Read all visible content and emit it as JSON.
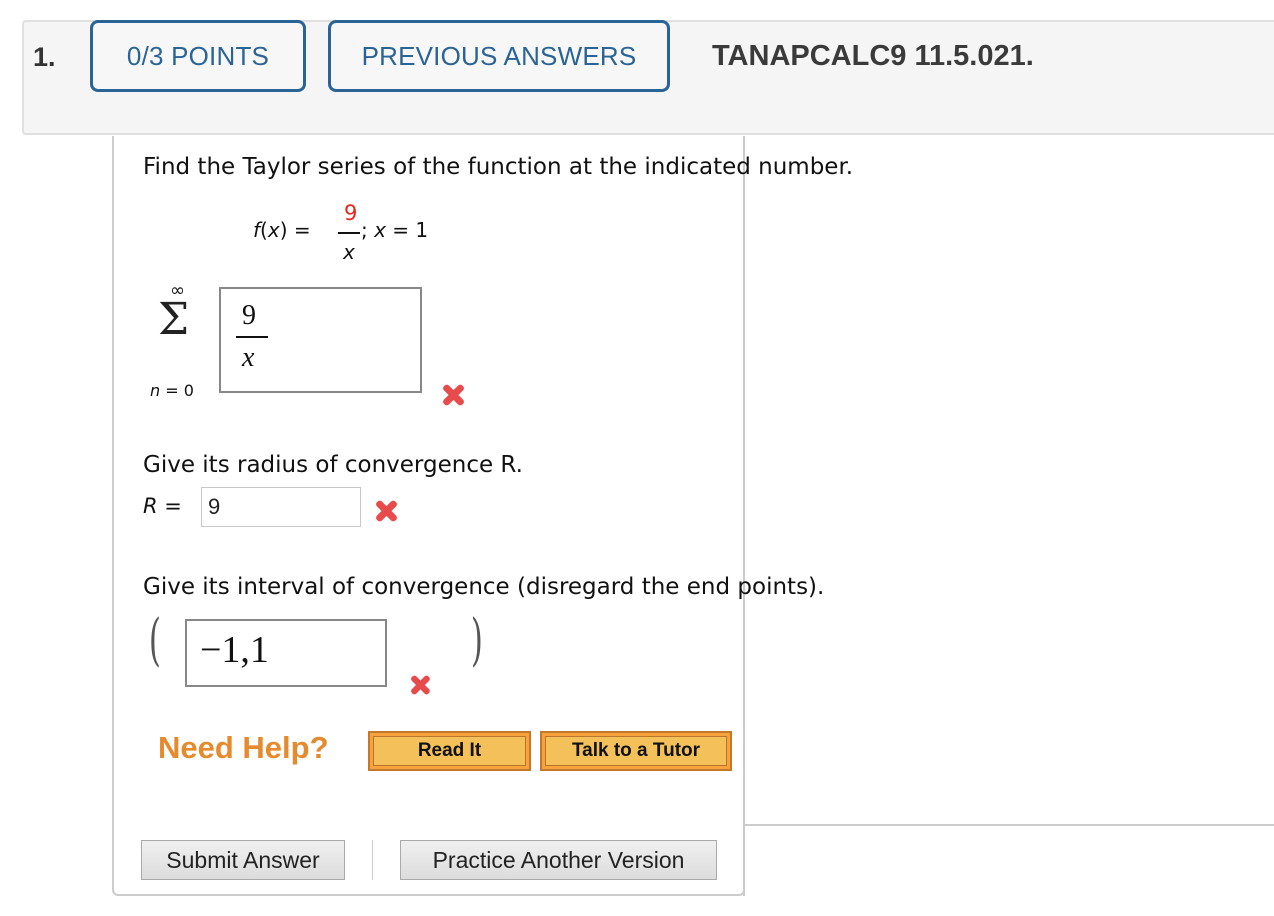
{
  "header": {
    "question_number": "1.",
    "points_label": "0/3 POINTS",
    "previous_answers_label": "PREVIOUS ANSWERS",
    "question_id": "TANAPCALC9 11.5.021."
  },
  "question": {
    "prompt": "Find the Taylor series of the function at the indicated number.",
    "function": {
      "lhs": "f(x) =",
      "numerator": "9",
      "denominator": "x",
      "rest": "; x = 1"
    },
    "series": {
      "upper_limit": "∞",
      "sigma": "Σ",
      "lower_limit_var": "n",
      "lower_limit_rest": " = 0",
      "answer_numerator": "9",
      "answer_denominator": "x",
      "status": "incorrect"
    },
    "radius": {
      "prompt": "Give its radius of convergence R.",
      "label_var": "R",
      "label_rest": " = ",
      "value": "9",
      "status": "incorrect"
    },
    "interval": {
      "prompt": "Give its interval of convergence (disregard the end points).",
      "left_paren": "(",
      "right_paren": ")",
      "value": "−1,1",
      "status": "incorrect"
    }
  },
  "help": {
    "label": "Need Help?",
    "read_it": "Read It",
    "talk_to_tutor": "Talk to a Tutor"
  },
  "actions": {
    "submit": "Submit Answer",
    "practice": "Practice Another Version"
  },
  "colors": {
    "accent_blue": "#2a6496",
    "error_red": "#e84b4b",
    "help_orange": "#e68a2e"
  }
}
